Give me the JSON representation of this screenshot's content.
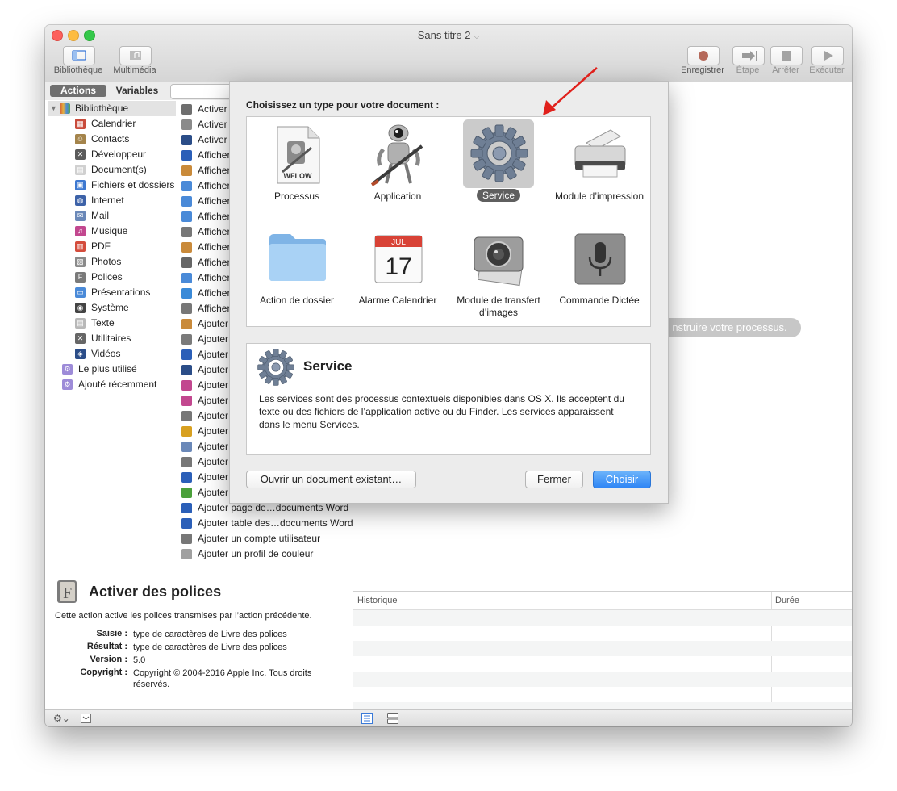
{
  "window": {
    "title": "Sans titre 2"
  },
  "toolbar": {
    "left": [
      {
        "label": "Bibliothèque",
        "icon": "library-panel-icon"
      },
      {
        "label": "Multimédia",
        "icon": "media-icon"
      }
    ],
    "right": [
      {
        "label": "Enregistrer",
        "icon": "record-icon"
      },
      {
        "label": "Étape",
        "icon": "step-icon"
      },
      {
        "label": "Arrêter",
        "icon": "stop-icon"
      },
      {
        "label": "Exécuter",
        "icon": "play-icon"
      }
    ]
  },
  "tabs": {
    "actions": "Actions",
    "variables": "Variables"
  },
  "library": {
    "root": "Bibliothèque",
    "items": [
      "Calendrier",
      "Contacts",
      "Développeur",
      "Document(s)",
      "Fichiers et dossiers",
      "Internet",
      "Mail",
      "Musique",
      "PDF",
      "Photos",
      "Polices",
      "Présentations",
      "Système",
      "Texte",
      "Utilitaires",
      "Vidéos"
    ],
    "smart": [
      "Le plus utilisé",
      "Ajouté récemment"
    ]
  },
  "actions_list": [
    "Activer",
    "Activer",
    "Activer",
    "Afficher",
    "Afficher",
    "Afficher",
    "Afficher",
    "Afficher",
    "Afficher",
    "Afficher",
    "Afficher",
    "Afficher",
    "Afficher",
    "Afficher",
    "Ajouter",
    "Ajouter",
    "Ajouter",
    "Ajouter",
    "Ajouter",
    "Ajouter",
    "Ajouter",
    "Ajouter",
    "Ajouter",
    "Ajouter",
    "Ajouter",
    "Ajouter nouvelle…ille aux classeurs",
    "Ajouter page de…documents Word",
    "Ajouter table des…documents Word",
    "Ajouter un compte utilisateur",
    "Ajouter un profil de couleur"
  ],
  "workflow": {
    "hint": "nstruire votre processus."
  },
  "history": {
    "col1": "Historique",
    "col2": "Durée"
  },
  "action_desc": {
    "title": "Activer des polices",
    "body": "Cette action active les polices transmises par l’action précédente.",
    "meta": [
      {
        "key": "Saisie :",
        "value": "type de caractères de Livre des polices"
      },
      {
        "key": "Résultat :",
        "value": "type de caractères de Livre des polices"
      },
      {
        "key": "Version :",
        "value": "5.0"
      },
      {
        "key": "Copyright :",
        "value": "Copyright © 2004-2016 Apple Inc. Tous droits réservés."
      }
    ]
  },
  "sheet": {
    "prompt": "Choisissez un type pour votre document :",
    "types": [
      {
        "label": "Processus",
        "icon": "workflow-file-icon",
        "badge": "WFLOW"
      },
      {
        "label": "Application",
        "icon": "automator-robot-icon"
      },
      {
        "label": "Service",
        "icon": "gear-icon",
        "selected": true
      },
      {
        "label": "Module d’impression",
        "icon": "printer-icon"
      },
      {
        "label": "Action de dossier",
        "icon": "folder-icon"
      },
      {
        "label": "Alarme Calendrier",
        "icon": "calendar-icon",
        "month": "JUL",
        "day": "17"
      },
      {
        "label": "Module de transfert d’images",
        "icon": "camera-icon"
      },
      {
        "label": "Commande Dictée",
        "icon": "microphone-icon"
      }
    ],
    "info": {
      "title": "Service",
      "text": "Les services sont des processus contextuels disponibles dans OS X. Ils acceptent du texte ou des fichiers de l’application active ou du Finder. Les services apparaissent dans le menu Services."
    },
    "buttons": {
      "open": "Ouvrir un document existant…",
      "close": "Fermer",
      "choose": "Choisir"
    }
  },
  "colors": {
    "accent": "#2f86f5",
    "arrow": "#e0201b",
    "selection": "#c8c8c8"
  }
}
